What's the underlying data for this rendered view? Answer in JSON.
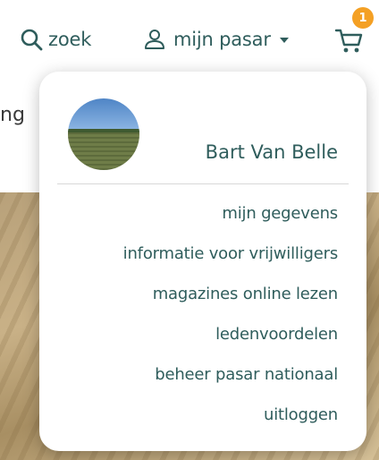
{
  "header": {
    "search_label": "zoek",
    "account_label": "mijn pasar",
    "cart_count": "1"
  },
  "background": {
    "heading_fragment": "ng"
  },
  "dropdown": {
    "user_name": "Bart Van Belle",
    "menu_items": [
      "mijn gegevens",
      "informatie voor vrijwilligers",
      "magazines online lezen",
      "ledenvoordelen",
      "beheer pasar nationaal",
      "uitloggen"
    ]
  },
  "colors": {
    "brand_teal": "#2f5d5c",
    "badge_orange": "#f4a024"
  },
  "icons": [
    "search-icon",
    "user-icon",
    "caret-down-icon",
    "cart-icon"
  ]
}
